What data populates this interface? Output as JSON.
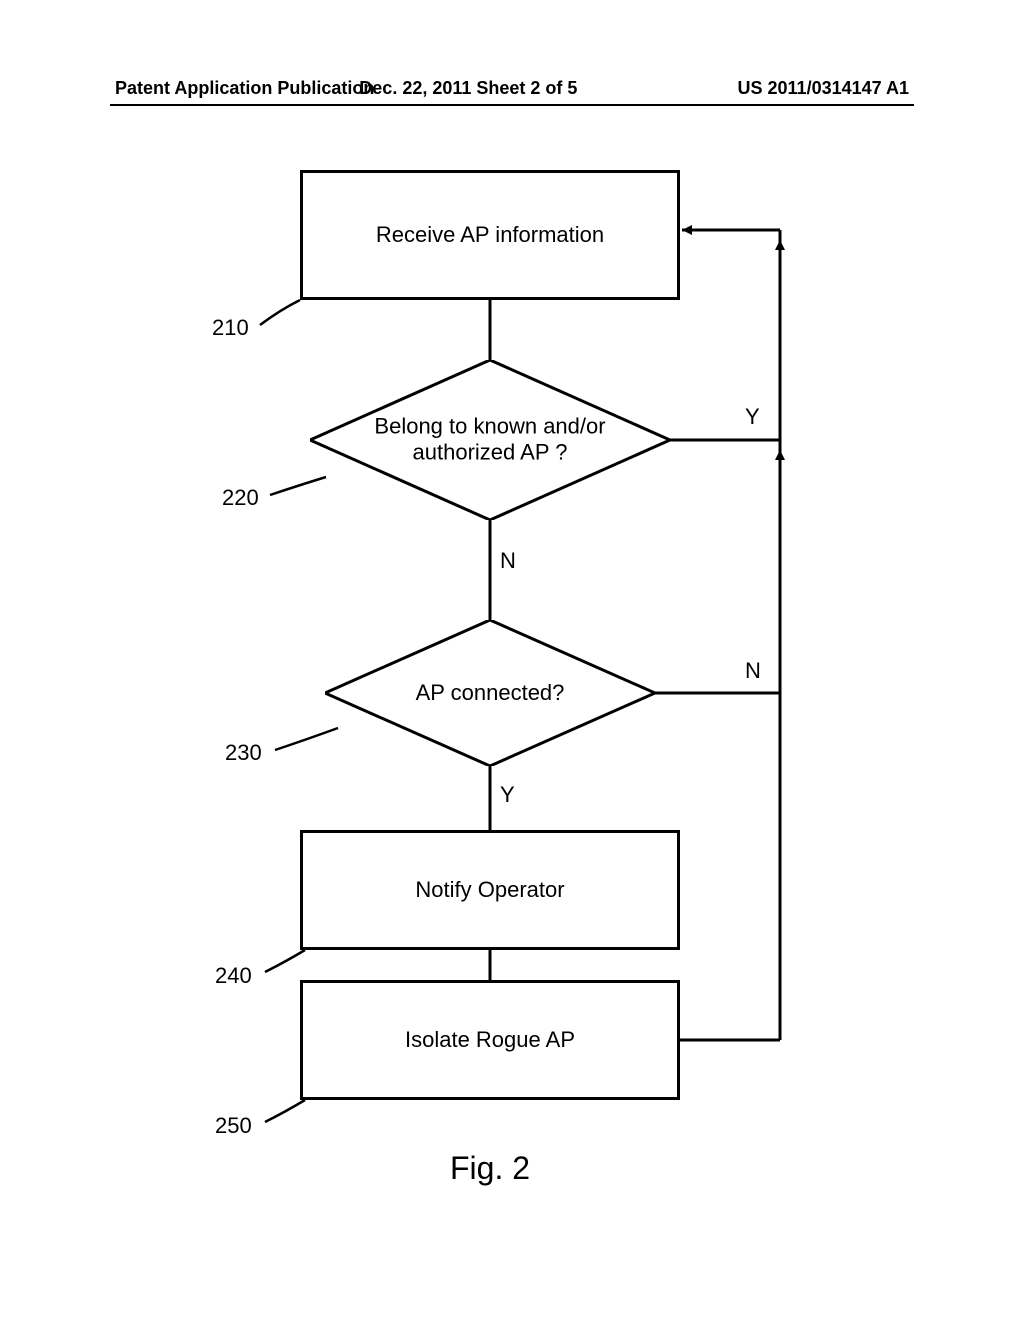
{
  "header": {
    "left": "Patent Application Publication",
    "center": "Dec. 22, 2011  Sheet 2 of 5",
    "right": "US 2011/0314147 A1"
  },
  "flowchart": {
    "step210": {
      "ref": "210",
      "text": "Receive AP information"
    },
    "step220": {
      "ref": "220",
      "text": "Belong to known and/or authorized AP ?",
      "yes": "Y",
      "no": "N"
    },
    "step230": {
      "ref": "230",
      "text": "AP connected?",
      "yes": "Y",
      "no": "N"
    },
    "step240": {
      "ref": "240",
      "text": "Notify Operator"
    },
    "step250": {
      "ref": "250",
      "text": "Isolate Rogue AP"
    }
  },
  "chart_data": {
    "type": "flowchart",
    "nodes": [
      {
        "id": "210",
        "shape": "process",
        "label": "Receive AP information"
      },
      {
        "id": "220",
        "shape": "decision",
        "label": "Belong to known and/or authorized AP ?"
      },
      {
        "id": "230",
        "shape": "decision",
        "label": "AP connected?"
      },
      {
        "id": "240",
        "shape": "process",
        "label": "Notify Operator"
      },
      {
        "id": "250",
        "shape": "process",
        "label": "Isolate Rogue AP"
      }
    ],
    "edges": [
      {
        "from": "210",
        "to": "220",
        "label": ""
      },
      {
        "from": "220",
        "to": "230",
        "label": "N"
      },
      {
        "from": "220",
        "to": "210",
        "label": "Y"
      },
      {
        "from": "230",
        "to": "240",
        "label": "Y"
      },
      {
        "from": "230",
        "to": "210",
        "label": "N"
      },
      {
        "from": "240",
        "to": "250",
        "label": ""
      },
      {
        "from": "250",
        "to": "210",
        "label": ""
      }
    ],
    "title": "Fig. 2"
  },
  "figure_caption": "Fig. 2"
}
